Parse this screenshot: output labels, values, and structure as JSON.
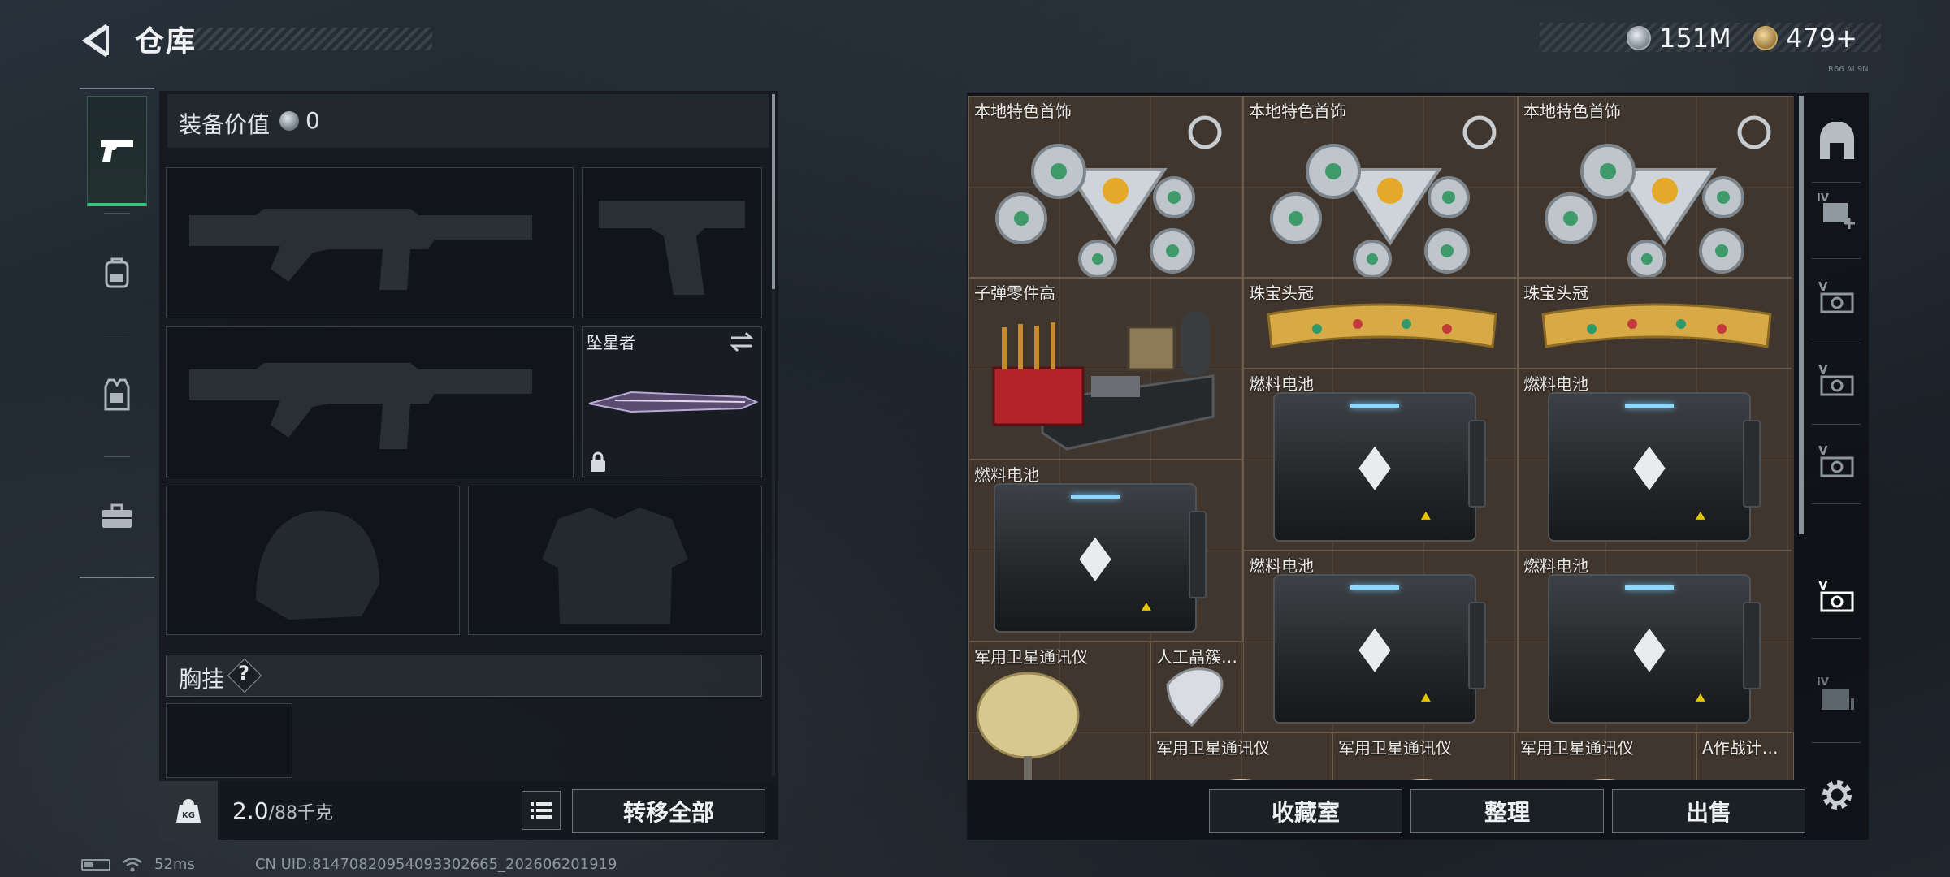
{
  "header": {
    "title": "仓库",
    "currency_silver": "151M",
    "currency_gold": "479+",
    "tiny_label": "R66 AI 9N"
  },
  "left_tabs": [
    {
      "name": "weapons",
      "icon": "pistol-icon",
      "active": true
    },
    {
      "name": "backpack",
      "icon": "backpack-icon",
      "active": false
    },
    {
      "name": "vest",
      "icon": "vest-icon",
      "active": false
    },
    {
      "name": "case",
      "icon": "briefcase-icon",
      "active": false
    }
  ],
  "equipment": {
    "value_label": "装备价值",
    "value": "0",
    "melee_name": "坠星者",
    "chest_label": "胸挂",
    "chest_help": "?"
  },
  "bottom_left": {
    "weight_current": "2.0",
    "weight_capacity": "/88千克",
    "weight_icon": "KG",
    "transfer_all": "转移全部"
  },
  "storage": {
    "items": [
      {
        "id": "jewel1",
        "name": "本地特色首饰"
      },
      {
        "id": "jewel2",
        "name": "本地特色首饰"
      },
      {
        "id": "jewel3",
        "name": "本地特色首饰"
      },
      {
        "id": "ammo",
        "name": "子弹零件高"
      },
      {
        "id": "crown1",
        "name": "珠宝头冠"
      },
      {
        "id": "crown2",
        "name": "珠宝头冠"
      },
      {
        "id": "fuel1",
        "name": "燃料电池"
      },
      {
        "id": "fuel2",
        "name": "燃料电池"
      },
      {
        "id": "fuel3",
        "name": "燃料电池"
      },
      {
        "id": "fuel4",
        "name": "燃料电池"
      },
      {
        "id": "fuel5",
        "name": "燃料电池"
      },
      {
        "id": "sat1",
        "name": "军用卫星通讯仪"
      },
      {
        "id": "crystal",
        "name": "人工晶簇…"
      },
      {
        "id": "sat2",
        "name": "军用卫星通讯仪"
      },
      {
        "id": "sat3",
        "name": "军用卫星通讯仪"
      },
      {
        "id": "sat4",
        "name": "军用卫星通讯仪"
      },
      {
        "id": "tactical",
        "name": "A作战计…"
      }
    ]
  },
  "side_tabs": [
    {
      "icon": "safe-icon",
      "label": ""
    },
    {
      "icon": "add-storage-icon",
      "label": "IV"
    },
    {
      "icon": "storage-v-icon",
      "label": "V"
    },
    {
      "icon": "storage-v-icon",
      "label": "V"
    },
    {
      "icon": "storage-v-icon",
      "label": "V"
    },
    {
      "icon": "storage-v-icon",
      "label": "V",
      "active": true
    },
    {
      "icon": "storage-iv-icon",
      "label": "IV"
    },
    {
      "icon": "gear-icon",
      "label": ""
    }
  ],
  "bottom_right": {
    "collection": "收藏室",
    "sort": "整理",
    "sell": "出售"
  },
  "footer": {
    "ping": "52ms",
    "uid": "CN UID:8147082095409330​2665_202606201919"
  },
  "colors": {
    "accent_green": "#37c47c",
    "grid_bg": "#3e342c",
    "panel_bg": "#12161b"
  }
}
